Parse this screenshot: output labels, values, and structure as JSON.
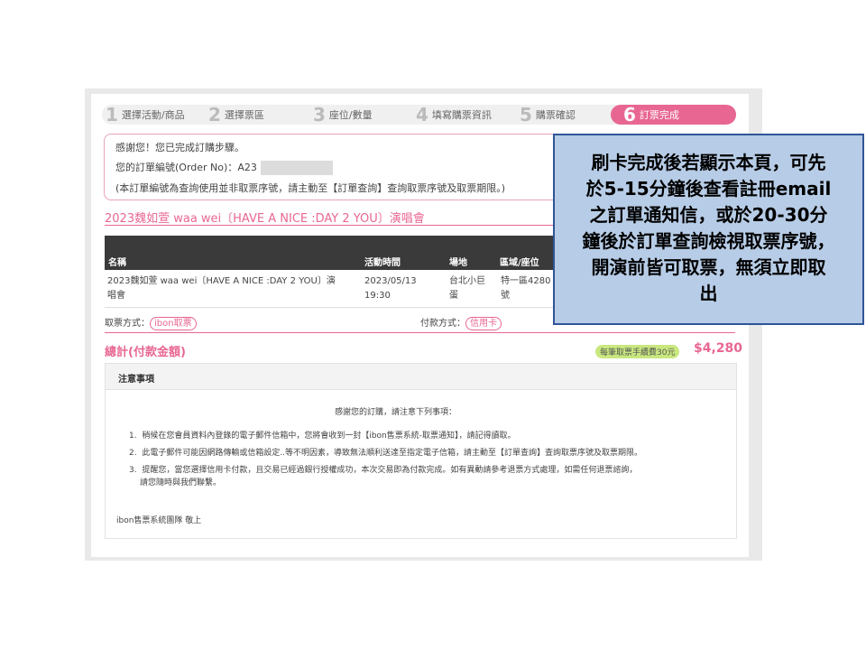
{
  "steps": [
    {
      "num": "1",
      "label": "選擇活動/商品"
    },
    {
      "num": "2",
      "label": "選擇票區"
    },
    {
      "num": "3",
      "label": "座位/數量"
    },
    {
      "num": "4",
      "label": "填寫購票資訊"
    },
    {
      "num": "5",
      "label": "購票確認"
    },
    {
      "num": "6",
      "label": "訂票完成"
    }
  ],
  "thanks": {
    "line1": "感謝您！您已完成訂購步驟。",
    "order_label": "您的訂單編號(Order  No)：",
    "order_no": "A23",
    "note": "(本訂單編號為查詢使用並非取票序號，請主動至【訂單查詢】查詢取票序號及取票期限。)"
  },
  "event_title": "2023魏如萱  waa  wei〔HAVE  A  NICE  :DAY  2  YOU〕演唱會",
  "table": {
    "headers": [
      "名稱",
      "活動時間",
      "場地",
      "區域/座位"
    ],
    "row": {
      "name_line1": "2023魏如萱  waa  wei〔HAVE  A  NICE  :DAY  2  YOU〕演",
      "name_line2": "唱會",
      "time_line1": "2023/05/13",
      "time_line2": "19:30",
      "venue_line1": "台北小巨",
      "venue_line2": "蛋",
      "seat_line1": "特一區4280",
      "seat_line2": "號"
    }
  },
  "pickup_label": "取票方式：",
  "pickup_value": "ibon取票",
  "payment_label": "付款方式：",
  "payment_value": "信用卡",
  "total_label": "總計(付款金額)",
  "fee_badge": "每筆取票手續費30元",
  "total_amount": "$4,280",
  "notes": {
    "title": "注意事項",
    "intro": "感謝您的訂購，請注意下列事項：",
    "items": [
      "稍候在您會員資料內登錄的電子郵件信箱中，您將會收到一封【ibon售票系統-取票通知】，請記得讀取。",
      "此電子郵件可能因網路傳輸或信箱設定..等不明因素，導致無法順利送達至指定電子信箱，請主動至【訂單查詢】查詢取票序號及取票期限。",
      "提醒您，當您選擇信用卡付款，且交易已經過銀行授權成功，本次交易即為付款完成。如有異動請參考退票方式處理，如需任何退票諮詢，",
      "請您隨時與我們聯繫。"
    ],
    "signature": "ibon售票系統團隊  敬上"
  },
  "callout": {
    "lines": [
      "刷卡完成後若顯示本頁，可先",
      "於5-15分鐘後查看註冊email",
      "之訂單通知信，或於20-30分",
      "鐘後於訂單查詢檢視取票序號，",
      "開演前皆可取票，無須立即取",
      "出"
    ]
  },
  "colors": {
    "accent": "#e86792",
    "callout_bg": "#b7cce6",
    "callout_border": "#2f5597",
    "fee_bg": "#c9e87f"
  }
}
